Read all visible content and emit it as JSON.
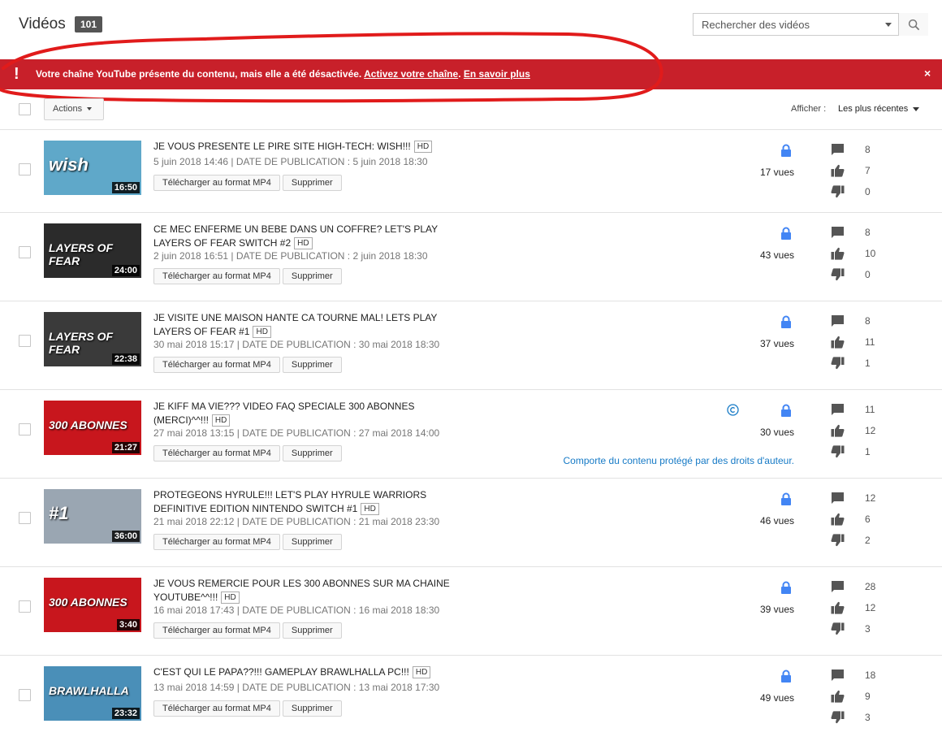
{
  "header": {
    "title": "Vidéos",
    "count": "101"
  },
  "search": {
    "placeholder": "Rechercher des vidéos"
  },
  "alert": {
    "message": "Votre chaîne YouTube présente du contenu, mais elle a été désactivée.",
    "link_activate": "Activez votre chaîne",
    "link_more": "En savoir plus",
    "close": "×"
  },
  "toolbar": {
    "actions_label": "Actions",
    "sort_label": "Afficher :",
    "sort_value": "Les plus récentes"
  },
  "labels": {
    "download": "Télécharger au format MP4",
    "delete": "Supprimer",
    "hd": "HD"
  },
  "videos": [
    {
      "title": "JE VOUS PRESENTE LE PIRE SITE HIGH-TECH: WISH!!!",
      "hd": true,
      "dates": "5 juin 2018 14:46 | DATE DE PUBLICATION : 5 juin 2018 18:30",
      "duration": "16:50",
      "views": "17 vues",
      "comments": "8",
      "likes": "7",
      "dislikes": "0",
      "thumb_text": "wish",
      "thumb_color": "#5fa8c9"
    },
    {
      "title": "CE MEC ENFERME UN BEBE DANS UN COFFRE? LET'S PLAY LAYERS OF FEAR SWITCH #2",
      "hd": true,
      "dates": "2 juin 2018 16:51 | DATE DE PUBLICATION : 2 juin 2018 18:30",
      "duration": "24:00",
      "views": "43 vues",
      "comments": "8",
      "likes": "10",
      "dislikes": "0",
      "thumb_text": "LAYERS OF FEAR",
      "thumb_color": "#2b2b2b"
    },
    {
      "title": "JE VISITE UNE MAISON HANTE CA TOURNE MAL! LETS PLAY LAYERS OF FEAR #1",
      "hd": true,
      "dates": "30 mai 2018 15:17 | DATE DE PUBLICATION : 30 mai 2018 18:30",
      "duration": "22:38",
      "views": "37 vues",
      "comments": "8",
      "likes": "11",
      "dislikes": "1",
      "thumb_text": "LAYERS OF FEAR",
      "thumb_color": "#3a3a3a"
    },
    {
      "title": "JE KIFF MA VIE??? VIDEO FAQ SPECIALE 300 ABONNES (MERCI)^^!!!",
      "hd": true,
      "dates": "27 mai 2018 13:15 | DATE DE PUBLICATION : 27 mai 2018 14:00",
      "duration": "21:27",
      "views": "30 vues",
      "comments": "11",
      "likes": "12",
      "dislikes": "1",
      "thumb_text": "300 ABONNES",
      "thumb_color": "#c8161d",
      "copyright": "Comporte du contenu protégé par des droits d'auteur."
    },
    {
      "title": "PROTEGEONS HYRULE!!! LET'S PLAY HYRULE WARRIORS DEFINITIVE EDITION NINTENDO SWITCH #1",
      "hd": true,
      "dates": "21 mai 2018 22:12 | DATE DE PUBLICATION : 21 mai 2018 23:30",
      "duration": "36:00",
      "views": "46 vues",
      "comments": "12",
      "likes": "6",
      "dislikes": "2",
      "thumb_text": "#1",
      "thumb_color": "#9aa6b2"
    },
    {
      "title": "JE VOUS REMERCIE POUR LES 300 ABONNES SUR MA CHAINE YOUTUBE^^!!!",
      "hd": true,
      "dates": "16 mai 2018 17:43 | DATE DE PUBLICATION : 16 mai 2018 18:30",
      "duration": "3:40",
      "views": "39 vues",
      "comments": "28",
      "likes": "12",
      "dislikes": "3",
      "thumb_text": "300 ABONNES",
      "thumb_color": "#c8161d"
    },
    {
      "title": "C'EST QUI LE PAPA??!!! GAMEPLAY BRAWLHALLA PC!!!",
      "hd": true,
      "dates": "13 mai 2018 14:59 | DATE DE PUBLICATION : 13 mai 2018 17:30",
      "duration": "23:32",
      "views": "49 vues",
      "comments": "18",
      "likes": "9",
      "dislikes": "3",
      "thumb_text": "BRAWLHALLA",
      "thumb_color": "#4a8fb8"
    }
  ],
  "colors": {
    "alert": "#c8202a",
    "lock": "#4285f4",
    "link": "#167ac6"
  }
}
